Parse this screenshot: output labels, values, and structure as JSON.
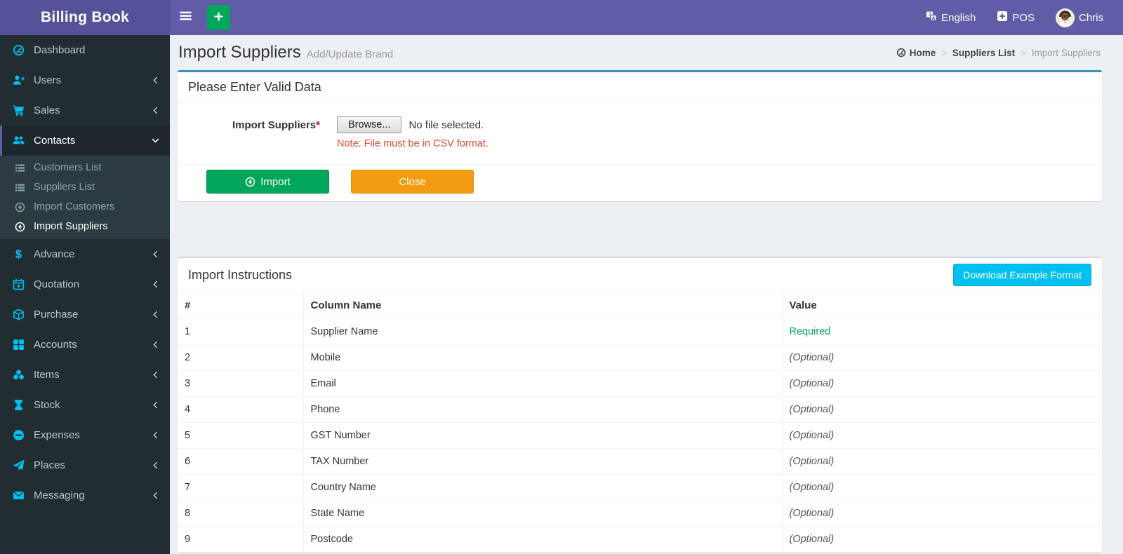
{
  "brand": {
    "title": "Billing Book"
  },
  "navbar": {
    "language_label": "English",
    "pos_label": "POS",
    "user_name": "Chris"
  },
  "sidebar": {
    "items": [
      {
        "label": "Dashboard",
        "icon": "dashboard",
        "chevron": null,
        "active": false
      },
      {
        "label": "Users",
        "icon": "user-plus",
        "chevron": "left",
        "active": false
      },
      {
        "label": "Sales",
        "icon": "cart",
        "chevron": "left",
        "active": false
      },
      {
        "label": "Contacts",
        "icon": "users",
        "chevron": "down",
        "active": true,
        "children": [
          {
            "label": "Customers List",
            "icon": "list",
            "active": false
          },
          {
            "label": "Suppliers List",
            "icon": "list",
            "active": false
          },
          {
            "label": "Import Customers",
            "icon": "arrow-circle-left",
            "active": false
          },
          {
            "label": "Import Suppliers",
            "icon": "arrow-circle-left",
            "active": true
          }
        ]
      },
      {
        "label": "Advance",
        "icon": "dollar",
        "chevron": "left",
        "active": false
      },
      {
        "label": "Quotation",
        "icon": "calendar-plus",
        "chevron": "left",
        "active": false
      },
      {
        "label": "Purchase",
        "icon": "cube",
        "chevron": "left",
        "active": false
      },
      {
        "label": "Accounts",
        "icon": "grid",
        "chevron": "left",
        "active": false
      },
      {
        "label": "Items",
        "icon": "cubes",
        "chevron": "left",
        "active": false
      },
      {
        "label": "Stock",
        "icon": "hourglass",
        "chevron": "left",
        "active": false
      },
      {
        "label": "Expenses",
        "icon": "minus-circle",
        "chevron": "left",
        "active": false
      },
      {
        "label": "Places",
        "icon": "paper-plane",
        "chevron": "left",
        "active": false
      },
      {
        "label": "Messaging",
        "icon": "envelope",
        "chevron": "left",
        "active": false
      }
    ]
  },
  "page": {
    "title": "Import Suppliers",
    "subtitle": "Add/Update Brand",
    "breadcrumb": [
      {
        "label": "Home",
        "icon": "dashboard",
        "current": false
      },
      {
        "label": "Suppliers List",
        "current": false
      },
      {
        "label": "Import Suppliers",
        "current": true
      }
    ]
  },
  "form_card": {
    "header": "Please Enter Valid Data",
    "field_label": "Import Suppliers",
    "required_mark": "*",
    "browse_label": "Browse...",
    "file_status": "No file selected.",
    "note": "Note: File must be in CSV format.",
    "import_button": "Import",
    "close_button": "Close"
  },
  "instructions_card": {
    "header": "Import Instructions",
    "download_button": "Download Example Format",
    "table": {
      "headers": [
        "#",
        "Column Name",
        "Value"
      ],
      "rows": [
        {
          "num": "1",
          "column": "Supplier Name",
          "value": "Required",
          "required": true
        },
        {
          "num": "2",
          "column": "Mobile",
          "value": "(Optional)",
          "required": false
        },
        {
          "num": "3",
          "column": "Email",
          "value": "(Optional)",
          "required": false
        },
        {
          "num": "4",
          "column": "Phone",
          "value": "(Optional)",
          "required": false
        },
        {
          "num": "5",
          "column": "GST Number",
          "value": "(Optional)",
          "required": false
        },
        {
          "num": "6",
          "column": "TAX Number",
          "value": "(Optional)",
          "required": false
        },
        {
          "num": "7",
          "column": "Country Name",
          "value": "(Optional)",
          "required": false
        },
        {
          "num": "8",
          "column": "State Name",
          "value": "(Optional)",
          "required": false
        },
        {
          "num": "9",
          "column": "Postcode",
          "value": "(Optional)",
          "required": false
        }
      ]
    }
  },
  "colors": {
    "navbar": "#605ca8",
    "logo": "#555299",
    "sidebar": "#222d32",
    "sidebar-active": "#1e282c",
    "submenu": "#2c3b41",
    "icon": "#00c0ef",
    "green": "#00a65a",
    "orange": "#f39c12",
    "info": "#00c0ef",
    "primary": "#3c8dbc",
    "bg": "#ecf0f5",
    "red": "#dd4b39",
    "required": "#00a65a"
  }
}
